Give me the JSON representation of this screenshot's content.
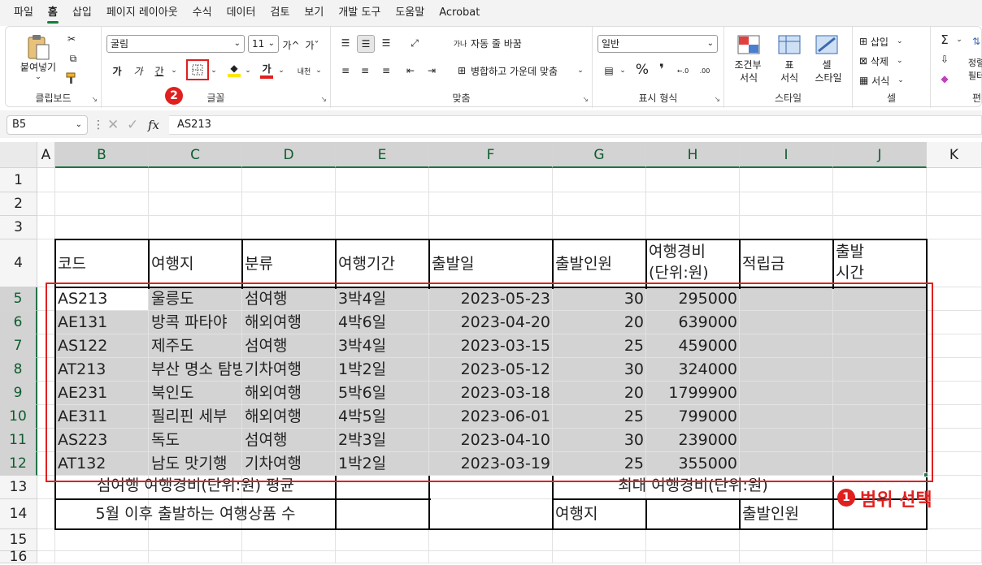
{
  "menu": [
    "파일",
    "홈",
    "삽입",
    "페이지 레이아웃",
    "수식",
    "데이터",
    "검토",
    "보기",
    "개발 도구",
    "도움말",
    "Acrobat"
  ],
  "ribbon": {
    "clipboard": {
      "paste": "붙여넣기",
      "label": "클립보드"
    },
    "font": {
      "name": "굴림",
      "size": "11",
      "grow": "가^",
      "shrink": "가ˇ",
      "bold": "가",
      "italic": "가",
      "underline": "간",
      "fontcolor": "가",
      "phonetic": "내천",
      "label": "글꼴",
      "badge": "2"
    },
    "align": {
      "wrap": "자동 줄 바꿈",
      "merge": "병합하고 가운데 맞춤",
      "label": "맞춤"
    },
    "number": {
      "format": "일반",
      "percent": "%",
      "comma": "❜",
      "label": "표시 형식"
    },
    "styles": {
      "cond1": "조건부",
      "cond2": "서식",
      "table1": "표",
      "table2": "서식",
      "cell1": "셀",
      "cell2": "스타일",
      "label": "스타일"
    },
    "cells": {
      "insert": "삽입",
      "delete": "삭제",
      "format": "서식",
      "label": "셀"
    },
    "editing": {
      "sort1": "정렬",
      "sort2": "필터",
      "label": "편"
    }
  },
  "formula": {
    "namebox": "B5",
    "fx": "fx",
    "content": "AS213"
  },
  "columns": [
    "A",
    "B",
    "C",
    "D",
    "E",
    "F",
    "G",
    "H",
    "I",
    "J",
    "K"
  ],
  "rows": [
    "1",
    "2",
    "3",
    "4",
    "5",
    "6",
    "7",
    "8",
    "9",
    "10",
    "11",
    "12",
    "13",
    "14",
    "15",
    "16"
  ],
  "table": {
    "headers": [
      "코드",
      "여행지",
      "분류",
      "여행기간",
      "출발일",
      "출발인원",
      "여행경비",
      "(단위:원)",
      "적립금",
      "출발",
      "시간"
    ],
    "data": [
      [
        "AS213",
        "울릉도",
        "섬여행",
        "3박4일",
        "2023-05-23",
        "30",
        "295000"
      ],
      [
        "AE131",
        "방콕 파타야",
        "해외여행",
        "4박6일",
        "2023-04-20",
        "20",
        "639000"
      ],
      [
        "AS122",
        "제주도",
        "섬여행",
        "3박4일",
        "2023-03-15",
        "25",
        "459000"
      ],
      [
        "AT213",
        "부산 명소 탐방",
        "기차여행",
        "1박2일",
        "2023-05-12",
        "30",
        "324000"
      ],
      [
        "AE231",
        "북인도",
        "해외여행",
        "5박6일",
        "2023-03-18",
        "20",
        "1799900"
      ],
      [
        "AE311",
        "필리핀 세부",
        "해외여행",
        "4박5일",
        "2023-06-01",
        "25",
        "799000"
      ],
      [
        "AS223",
        "독도",
        "섬여행",
        "2박3일",
        "2023-04-10",
        "30",
        "239000"
      ],
      [
        "AT132",
        "남도 맛기행",
        "기차여행",
        "1박2일",
        "2023-03-19",
        "25",
        "355000"
      ]
    ],
    "r13a": "섬여행 여행경비(단위:원) 평균",
    "r13b": "최대 여행경비(단위:원)",
    "r14a": "5월 이후 출발하는 여행상품 수",
    "r14b": "여행지",
    "r14c": "출발인원"
  },
  "annotation": {
    "badge": "1",
    "text": "범위 선택"
  },
  "colors": {
    "accent": "#217346",
    "red": "#e0201f",
    "selection": "#d3d3d3"
  }
}
